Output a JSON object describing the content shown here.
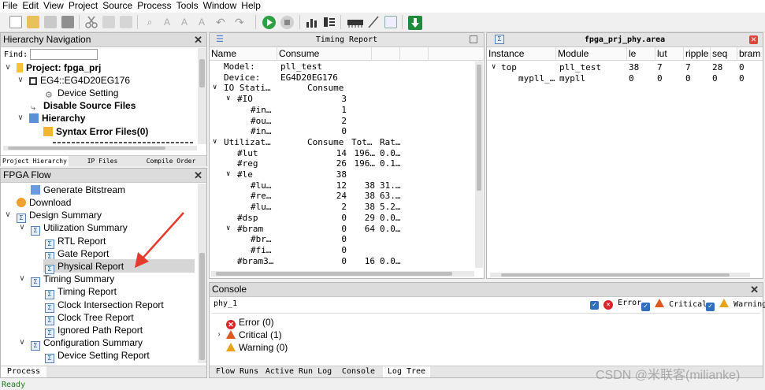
{
  "menu": [
    "File",
    "Edit",
    "View",
    "Project",
    "Source",
    "Process",
    "Tools",
    "Window",
    "Help"
  ],
  "hierarchy": {
    "title": "Hierarchy Navigation",
    "find_label": "Find:",
    "find_value": "",
    "items": [
      {
        "label": "Project: fpga_prj",
        "bold": true
      },
      {
        "label": "EG4::EG4D20EG176",
        "bold": false
      },
      {
        "label": "Device Setting",
        "bold": false
      },
      {
        "label": "Disable Source Files",
        "bold": true
      },
      {
        "label": "Hierarchy",
        "bold": true
      },
      {
        "label": "Syntax Error Files(0)",
        "bold": true
      }
    ],
    "tabs": [
      "Project Hierarchy",
      "IP Files",
      "Compile Order"
    ]
  },
  "flow": {
    "title": "FPGA Flow",
    "items": [
      {
        "label": "Generate Bitstream"
      },
      {
        "label": "Download"
      },
      {
        "label": "Design Summary"
      },
      {
        "label": "Utilization Summary"
      },
      {
        "label": "RTL Report"
      },
      {
        "label": "Gate Report"
      },
      {
        "label": "Physical Report"
      },
      {
        "label": "Timing Summary"
      },
      {
        "label": "Timing Report"
      },
      {
        "label": "Clock Intersection Report"
      },
      {
        "label": "Clock Tree Report"
      },
      {
        "label": "Ignored Path Report"
      },
      {
        "label": "Configuration Summary"
      },
      {
        "label": "Device Setting Report"
      }
    ],
    "tab": "Process"
  },
  "timing": {
    "title": "Timing Report",
    "col_name": "Name",
    "col_consume": "Consume",
    "rows": [
      {
        "c": "",
        "n": "Model:",
        "v": "pll_test",
        "t": "",
        "r": ""
      },
      {
        "c": "",
        "n": "Device:",
        "v": "EG4D20EG176",
        "t": "",
        "r": ""
      },
      {
        "c": "v",
        "n": "IO Stati…",
        "v": "Consume",
        "t": "",
        "r": ""
      },
      {
        "c": "v",
        "n": "#IO",
        "v": "3",
        "t": "",
        "r": ""
      },
      {
        "c": "",
        "n": "#in…",
        "v": "1",
        "t": "",
        "r": ""
      },
      {
        "c": "",
        "n": "#ou…",
        "v": "2",
        "t": "",
        "r": ""
      },
      {
        "c": "",
        "n": "#in…",
        "v": "0",
        "t": "",
        "r": ""
      },
      {
        "c": "v",
        "n": "Utilizat…",
        "v": "Consume",
        "t": "Tot…",
        "r": "Rat…"
      },
      {
        "c": "",
        "n": "#lut",
        "v": "14",
        "t": "196…",
        "r": "0.0…"
      },
      {
        "c": "",
        "n": "#reg",
        "v": "26",
        "t": "196…",
        "r": "0.1…"
      },
      {
        "c": "v",
        "n": "#le",
        "v": "38",
        "t": "",
        "r": ""
      },
      {
        "c": "",
        "n": "#lu…",
        "v": "12",
        "t": "38",
        "r": "31.…"
      },
      {
        "c": "",
        "n": "#re…",
        "v": "24",
        "t": "38",
        "r": "63.…"
      },
      {
        "c": "",
        "n": "#lu…",
        "v": "2",
        "t": "38",
        "r": "5.2…"
      },
      {
        "c": "",
        "n": "#dsp",
        "v": "0",
        "t": "29",
        "r": "0.0…"
      },
      {
        "c": "v",
        "n": "#bram",
        "v": "0",
        "t": "64",
        "r": "0.0…"
      },
      {
        "c": "",
        "n": "#br…",
        "v": "0",
        "t": "",
        "r": ""
      },
      {
        "c": "",
        "n": "#fi…",
        "v": "0",
        "t": "",
        "r": ""
      },
      {
        "c": "",
        "n": "#bram3…",
        "v": "0",
        "t": "16",
        "r": "0.0…"
      }
    ]
  },
  "area": {
    "title": "fpga_prj_phy.area",
    "columns": [
      "Instance",
      "Module",
      "le",
      "lut",
      "ripple",
      "seq",
      "bram"
    ],
    "rows": [
      {
        "caret": "v",
        "instance": "top",
        "module": "pll_test",
        "le": "38",
        "lut": "7",
        "ripple": "7",
        "seq": "28",
        "bram": "0"
      },
      {
        "caret": "",
        "instance": "mypll_…",
        "module": "mypll",
        "le": "0",
        "lut": "0",
        "ripple": "0",
        "seq": "0",
        "bram": "0"
      }
    ]
  },
  "console": {
    "title": "Console",
    "filter_name": "phy_1",
    "filters": [
      "Error",
      "Critical",
      "Warning"
    ],
    "items": [
      {
        "label": "Error (0)"
      },
      {
        "label": "Critical (1)"
      },
      {
        "label": "Warning (0)"
      }
    ],
    "tabs": [
      "Flow Runs",
      "Active Run Log",
      "Console",
      "Log Tree"
    ]
  },
  "status": "Ready",
  "watermark": "CSDN @米联客(milianke)",
  "colors": {
    "accent": "#2f6fbd",
    "error": "#d9262b",
    "warning": "#e8a317",
    "arrow": "#e53b2c",
    "status_text": "#1f7a1f"
  }
}
